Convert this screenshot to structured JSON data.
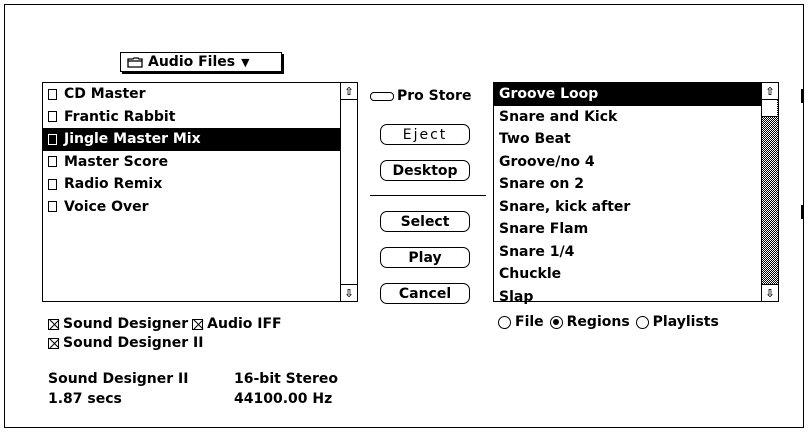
{
  "dialog": {
    "folder_popup": {
      "label": "Audio Files",
      "icon": "folder-icon"
    },
    "file_list": {
      "items": [
        {
          "name": "CD Master",
          "selected": false
        },
        {
          "name": "Frantic Rabbit",
          "selected": false
        },
        {
          "name": "Jingle Master Mix",
          "selected": true
        },
        {
          "name": "Master Score",
          "selected": false
        },
        {
          "name": "Radio Remix",
          "selected": false
        },
        {
          "name": "Voice Over",
          "selected": false
        }
      ]
    },
    "disk_label": "Pro Store",
    "buttons": {
      "eject": "Eject",
      "desktop": "Desktop",
      "select": "Select",
      "play": "Play",
      "cancel": "Cancel"
    },
    "region_list": {
      "items": [
        {
          "name": "Groove Loop",
          "selected": true
        },
        {
          "name": "Snare and Kick",
          "selected": false
        },
        {
          "name": "Two Beat",
          "selected": false
        },
        {
          "name": "Groove/no 4",
          "selected": false
        },
        {
          "name": "Snare on 2",
          "selected": false
        },
        {
          "name": "Snare, kick after",
          "selected": false
        },
        {
          "name": "Snare Flam",
          "selected": false
        },
        {
          "name": "Snare 1/4",
          "selected": false
        },
        {
          "name": "Chuckle",
          "selected": false
        },
        {
          "name": "Slap",
          "selected": false
        }
      ]
    },
    "formats": [
      {
        "label": "Sound Designer",
        "checked": true
      },
      {
        "label": "Audio IFF",
        "checked": true
      },
      {
        "label": "Sound Designer II",
        "checked": true
      }
    ],
    "view_options": [
      {
        "label": "File",
        "selected": false
      },
      {
        "label": "Regions",
        "selected": true
      },
      {
        "label": "Playlists",
        "selected": false
      }
    ],
    "info": {
      "format": "Sound Designer II",
      "channels": "16-bit Stereo",
      "duration": "1.87 secs",
      "sample_rate": "44100.00 Hz"
    }
  }
}
